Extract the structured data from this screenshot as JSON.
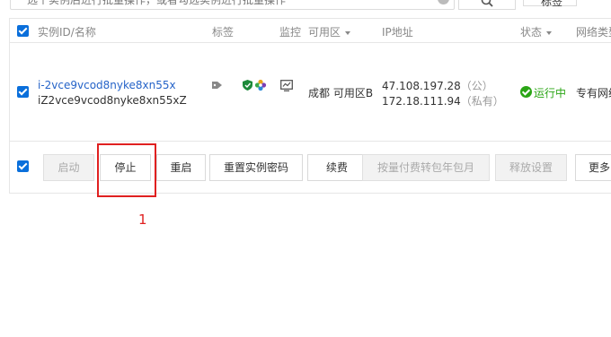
{
  "search": {
    "text": "选个实例后进行批量操作，或者勾选实例进行批量操作",
    "search_icon": "search-icon",
    "tag_button": "标签"
  },
  "table": {
    "headers": {
      "id_name": "实例ID/名称",
      "tags": "标签",
      "monitor": "监控",
      "zone": "可用区",
      "ip": "IP地址",
      "status": "状态",
      "network": "网络类型"
    },
    "rows": [
      {
        "instance_id": "i-2vce9vcod8nyke8xn55x",
        "instance_name": "iZ2vce9vcod8nyke8xn55xZ",
        "zone": "成都 可用区B",
        "public_ip": "47.108.197.28",
        "public_suffix": "（公）",
        "private_ip": "172.18.111.94",
        "private_suffix": "（私有）",
        "status": "运行中",
        "network": "专有网络"
      }
    ]
  },
  "actions": {
    "start": "启动",
    "stop": "停止",
    "restart": "重启",
    "reset_password": "重置实例密码",
    "renew": "续费",
    "convert_billing": "按量付费转包年包月",
    "release_settings": "释放设置",
    "more": "更多"
  },
  "annotation": {
    "label": "1",
    "color": "#e02020"
  },
  "colors": {
    "accent": "#0a6fdb",
    "running": "#2aa515",
    "link": "#2563c8"
  }
}
